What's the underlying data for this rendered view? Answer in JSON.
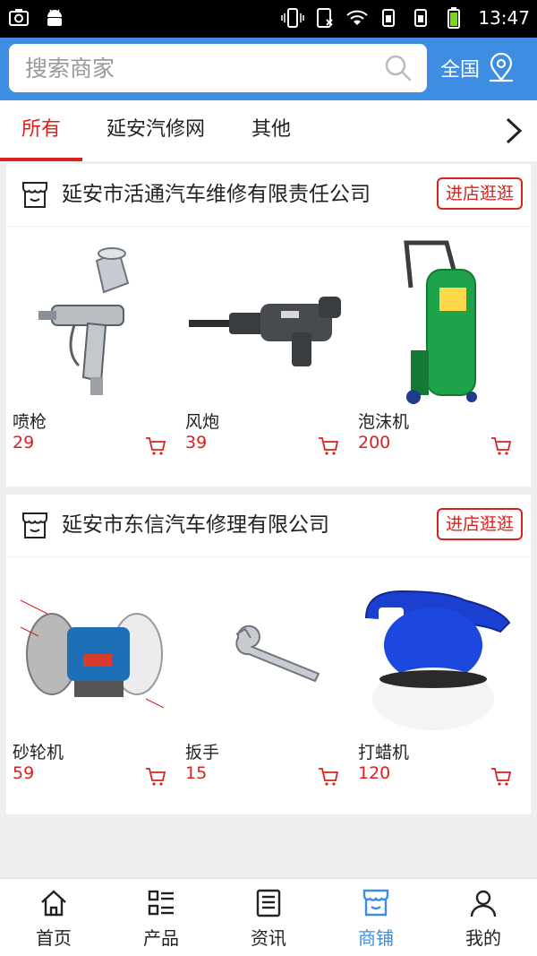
{
  "status_bar": {
    "time": "13:47"
  },
  "search": {
    "placeholder": "搜索商家",
    "value": ""
  },
  "region": {
    "label": "全国"
  },
  "tabs": [
    {
      "label": "所有",
      "active": true
    },
    {
      "label": "延安汽修网",
      "active": false
    },
    {
      "label": "其他",
      "active": false
    }
  ],
  "shops": [
    {
      "name": "延安市活通汽车维修有限责任公司",
      "visit_label": "进店逛逛",
      "products": [
        {
          "name": "喷枪",
          "price": "29",
          "image": "spray-gun"
        },
        {
          "name": "风炮",
          "price": "39",
          "image": "impact-wrench"
        },
        {
          "name": "泡沫机",
          "price": "200",
          "image": "foam-machine"
        }
      ]
    },
    {
      "name": "延安市东信汽车修理有限公司",
      "visit_label": "进店逛逛",
      "products": [
        {
          "name": "砂轮机",
          "price": "59",
          "image": "bench-grinder"
        },
        {
          "name": "扳手",
          "price": "15",
          "image": "adjustable-wrench"
        },
        {
          "name": "打蜡机",
          "price": "120",
          "image": "waxing-machine"
        }
      ]
    }
  ],
  "bottom_nav": [
    {
      "label": "首页",
      "icon": "home-icon",
      "active": false
    },
    {
      "label": "产品",
      "icon": "grid-list-icon",
      "active": false
    },
    {
      "label": "资讯",
      "icon": "news-icon",
      "active": false
    },
    {
      "label": "商铺",
      "icon": "store-icon",
      "active": true
    },
    {
      "label": "我的",
      "icon": "user-icon",
      "active": false
    }
  ],
  "colors": {
    "brand_blue": "#3d8ee2",
    "accent_red": "#d9211e",
    "bg_gray": "#eeeeee"
  }
}
